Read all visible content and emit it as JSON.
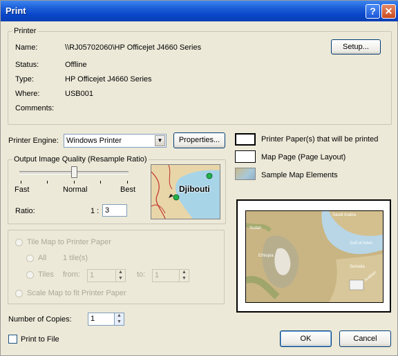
{
  "window": {
    "title": "Print",
    "help_glyph": "?",
    "close_glyph": "✕"
  },
  "printer": {
    "legend": "Printer",
    "name_label": "Name:",
    "name": "\\\\RJ05702060\\HP Officejet J4660 Series",
    "status_label": "Status:",
    "status": "Offline",
    "type_label": "Type:",
    "type": "HP Officejet J4660 Series",
    "where_label": "Where:",
    "where": "USB001",
    "comments_label": "Comments:",
    "comments": "",
    "setup_label": "Setup..."
  },
  "engine": {
    "label": "Printer Engine:",
    "value": "Windows Printer",
    "properties_label": "Properties..."
  },
  "quality": {
    "legend": "Output Image Quality (Resample Ratio)",
    "fast": "Fast",
    "normal": "Normal",
    "best": "Best",
    "ratio_label": "Ratio:",
    "ratio_prefix": "1 :",
    "ratio_value": "3",
    "slider_level": 0.5,
    "preview_label": "Djibouti"
  },
  "tiling": {
    "tile_map": "Tile Map to Printer Paper",
    "all": "All",
    "tiles_count": "1 tile(s)",
    "tiles": "Tiles",
    "from": "from:",
    "from_value": "1",
    "to": "to:",
    "to_value": "1",
    "scale_map": "Scale Map to fit Printer Paper"
  },
  "legend_items": {
    "paper": "Printer Paper(s) that will be printed",
    "map_page": "Map Page (Page Layout)",
    "sample": "Sample Map Elements"
  },
  "preview_map": {
    "labels": [
      "Saudi Arabia",
      "Sudan",
      "Gulf of Aden",
      "Ethiopia",
      "Somalia",
      "Arabian"
    ]
  },
  "copies": {
    "label": "Number of Copies:",
    "value": "1"
  },
  "print_to_file": {
    "label": "Print to File",
    "checked": false
  },
  "buttons": {
    "ok": "OK",
    "cancel": "Cancel"
  },
  "colors": {
    "titlebar": "#0845C8",
    "dialog": "#ECE9D8",
    "disabled_text": "#ACA899",
    "button_border": "#003C74"
  }
}
